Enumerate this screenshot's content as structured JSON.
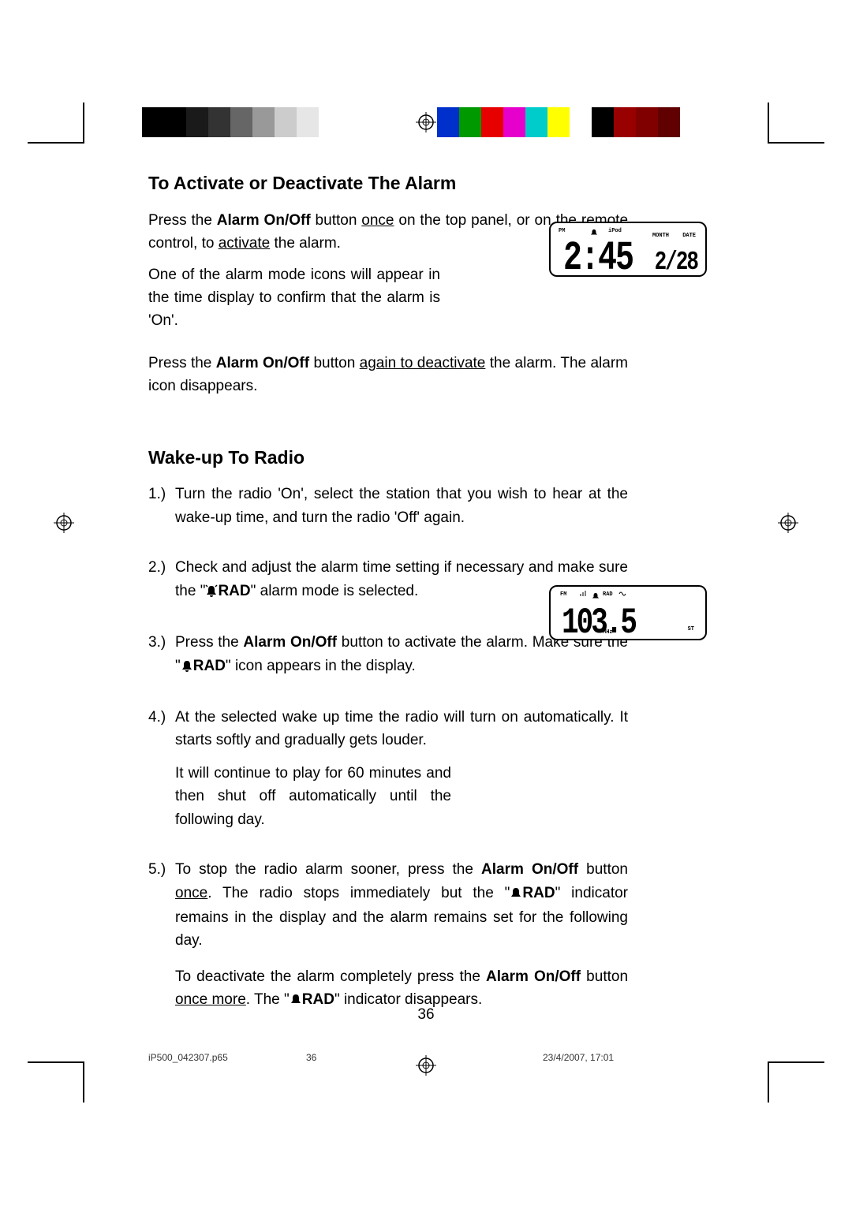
{
  "section1": {
    "heading": "To Activate or Deactivate The Alarm",
    "p1_a": "Press the ",
    "p1_b": "Alarm On/Off",
    "p1_c": " button ",
    "p1_d": "once",
    "p1_e": " on the top panel, or on the remote control, to ",
    "p1_f": "activate",
    "p1_g": " the alarm.",
    "p2": "One of the alarm mode icons will appear in the time display to confirm that the alarm is 'On'.",
    "p3_a": "Press the ",
    "p3_b": "Alarm On/Off",
    "p3_c": " button ",
    "p3_d": "again to deactivate",
    "p3_e": " the alarm. The alarm icon disappears."
  },
  "section2": {
    "heading": "Wake-up To Radio",
    "item1_num": "1.)",
    "item1": "Turn the radio 'On', select the station that you wish to hear at the wake-up time, and turn the radio 'Off' again.",
    "item2_num": "2.)",
    "item2_a": "Check and adjust the alarm time setting if necessary and make sure the \"",
    "item2_b": "RAD",
    "item2_c": "\" alarm mode is selected.",
    "item3_num": "3.)",
    "item3_a": "Press the ",
    "item3_b": "Alarm On/Off",
    "item3_c": " button to activate the alarm. Make sure the \"",
    "item3_d": "RAD",
    "item3_e": "\" icon appears in the display.",
    "item4_num": "4.)",
    "item4_a": "At the selected wake up time the radio will turn on automatically. It starts softly and gradually gets louder.",
    "item4_b": "It will continue to play for 60 minutes and then shut off automatically until the following day.",
    "item5_num": "5.)",
    "item5_a": "To stop the radio alarm sooner, press the ",
    "item5_b": "Alarm On/Off",
    "item5_c": " button ",
    "item5_d": "once",
    "item5_e": ". The radio stops immediately but the \"",
    "item5_f": "RAD",
    "item5_g": "\" indicator remains in the display and the alarm remains set for the following day.",
    "item5_h_a": "To deactivate the alarm completely press the ",
    "item5_h_b": "Alarm On/Off",
    "item5_h_c": " button ",
    "item5_h_d": "once more",
    "item5_h_e": ". The \"",
    "item5_h_f": "RAD",
    "item5_h_g": "\" indicator disappears."
  },
  "lcd1": {
    "pm": "PM",
    "ipod": "iPod",
    "time": "2:45",
    "month_lbl": "MONTH",
    "date_lbl": "DATE",
    "date": "2/28"
  },
  "lcd2": {
    "fm": "FM",
    "rad": "RAD",
    "freq": "103.5",
    "mhz": "MHz",
    "st": "ST"
  },
  "page_number": "36",
  "footer": {
    "file": "iP500_042307.p65",
    "page": "36",
    "timestamp": "23/4/2007, 17:01"
  }
}
